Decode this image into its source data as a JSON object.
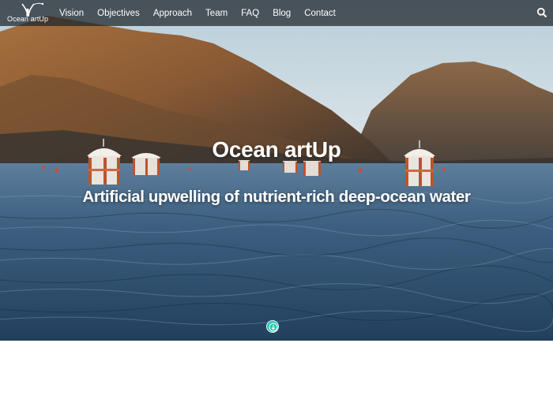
{
  "logo": {
    "text": "Ocean artUp"
  },
  "nav": {
    "items": [
      {
        "label": "Vision"
      },
      {
        "label": "Objectives"
      },
      {
        "label": "Approach"
      },
      {
        "label": "Team"
      },
      {
        "label": "FAQ"
      },
      {
        "label": "Blog"
      },
      {
        "label": "Contact"
      }
    ],
    "search_icon": "search-icon"
  },
  "hero": {
    "title": "Ocean artUp",
    "subtitle": "Artificial upwelling of nutrient-rich deep-ocean water",
    "scroll_icon": "arrow-down-circle-icon"
  },
  "colors": {
    "nav_bg": "#1c2228",
    "accent": "#1fc7b0",
    "text": "#ffffff"
  }
}
